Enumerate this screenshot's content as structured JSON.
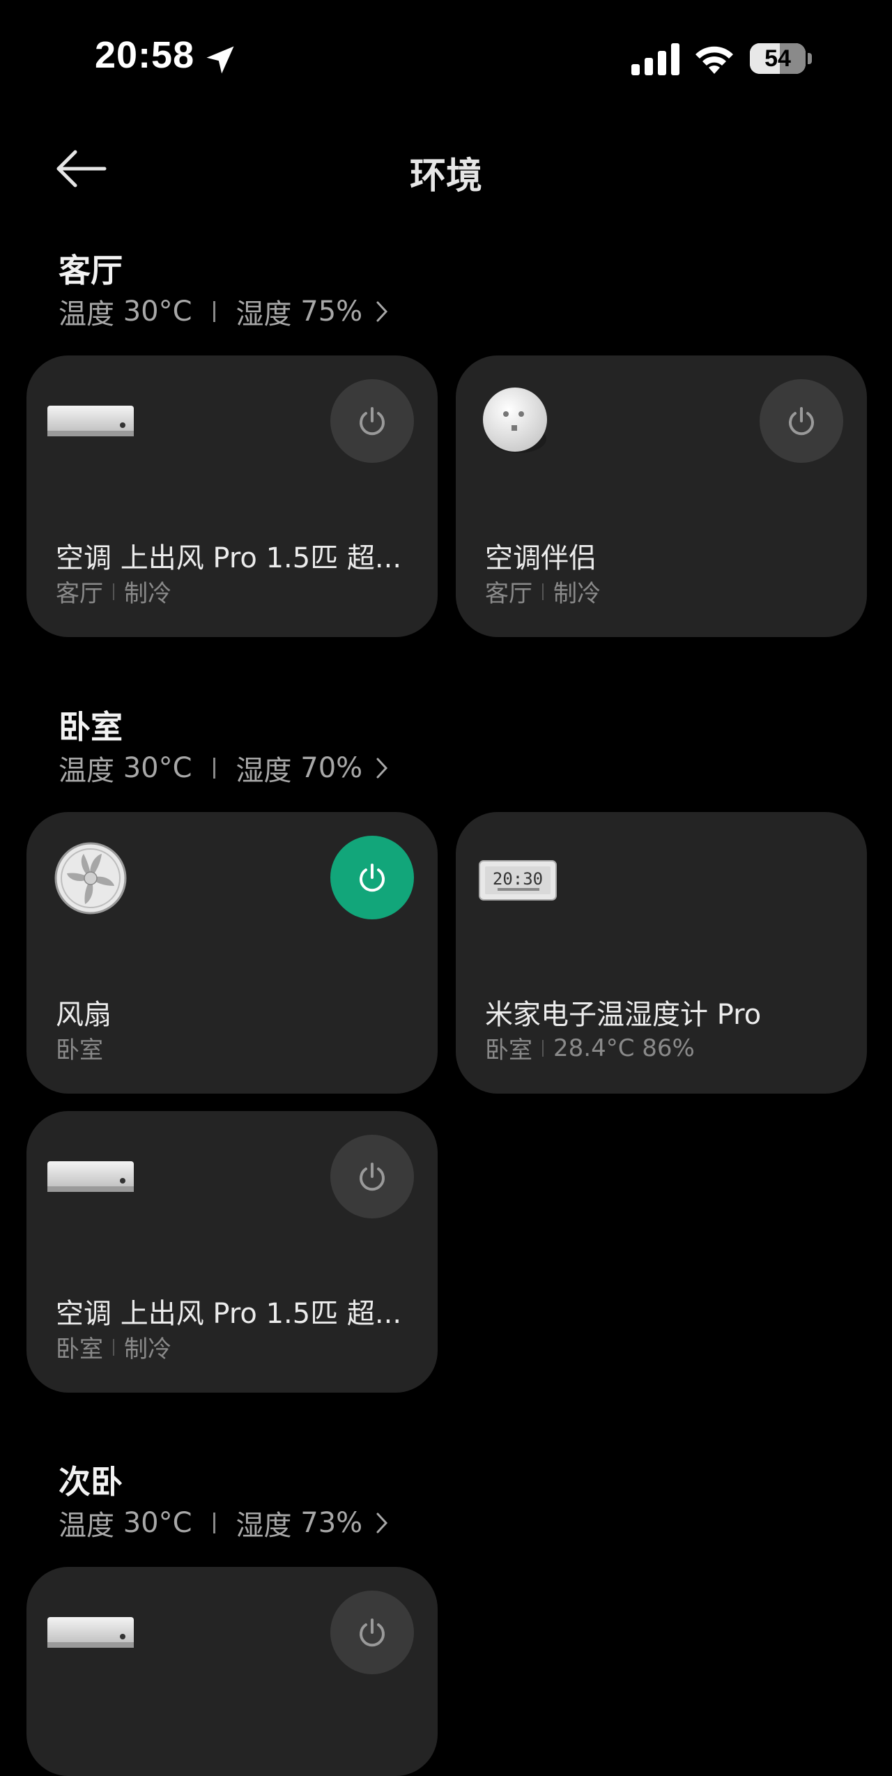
{
  "status": {
    "time": "20:58",
    "battery": "54",
    "battery_level": 0.54
  },
  "nav": {
    "title": "环境"
  },
  "colors": {
    "power_on": "#12a67a",
    "card_bg": "#242424",
    "power_off": "#3a3a3a"
  },
  "rooms": [
    {
      "name": "客厅",
      "temp_label": "温度",
      "temp": "30°C",
      "humidity_label": "湿度",
      "humidity": "75%",
      "devices": [
        {
          "name": "空调 上出风 Pro 1.5匹 超...",
          "room": "客厅",
          "status": "制冷",
          "icon": "air-conditioner",
          "power": "off"
        },
        {
          "name": "空调伴侣",
          "room": "客厅",
          "status": "制冷",
          "icon": "ac-companion-plug",
          "power": "off"
        }
      ]
    },
    {
      "name": "卧室",
      "temp_label": "温度",
      "temp": "30°C",
      "humidity_label": "湿度",
      "humidity": "70%",
      "devices": [
        {
          "name": "风扇",
          "room": "卧室",
          "icon": "fan",
          "power": "on"
        },
        {
          "name": "米家电子温湿度计 Pro",
          "room": "卧室",
          "status": "28.4°C 86%",
          "icon": "thermo-hygrometer",
          "clock_text": "20:30"
        },
        {
          "name": "空调 上出风 Pro 1.5匹 超...",
          "room": "卧室",
          "status": "制冷",
          "icon": "air-conditioner",
          "power": "off"
        }
      ]
    },
    {
      "name": "次卧",
      "temp_label": "温度",
      "temp": "30°C",
      "humidity_label": "湿度",
      "humidity": "73%",
      "devices": [
        {
          "icon": "air-conditioner",
          "power": "off"
        }
      ]
    }
  ]
}
